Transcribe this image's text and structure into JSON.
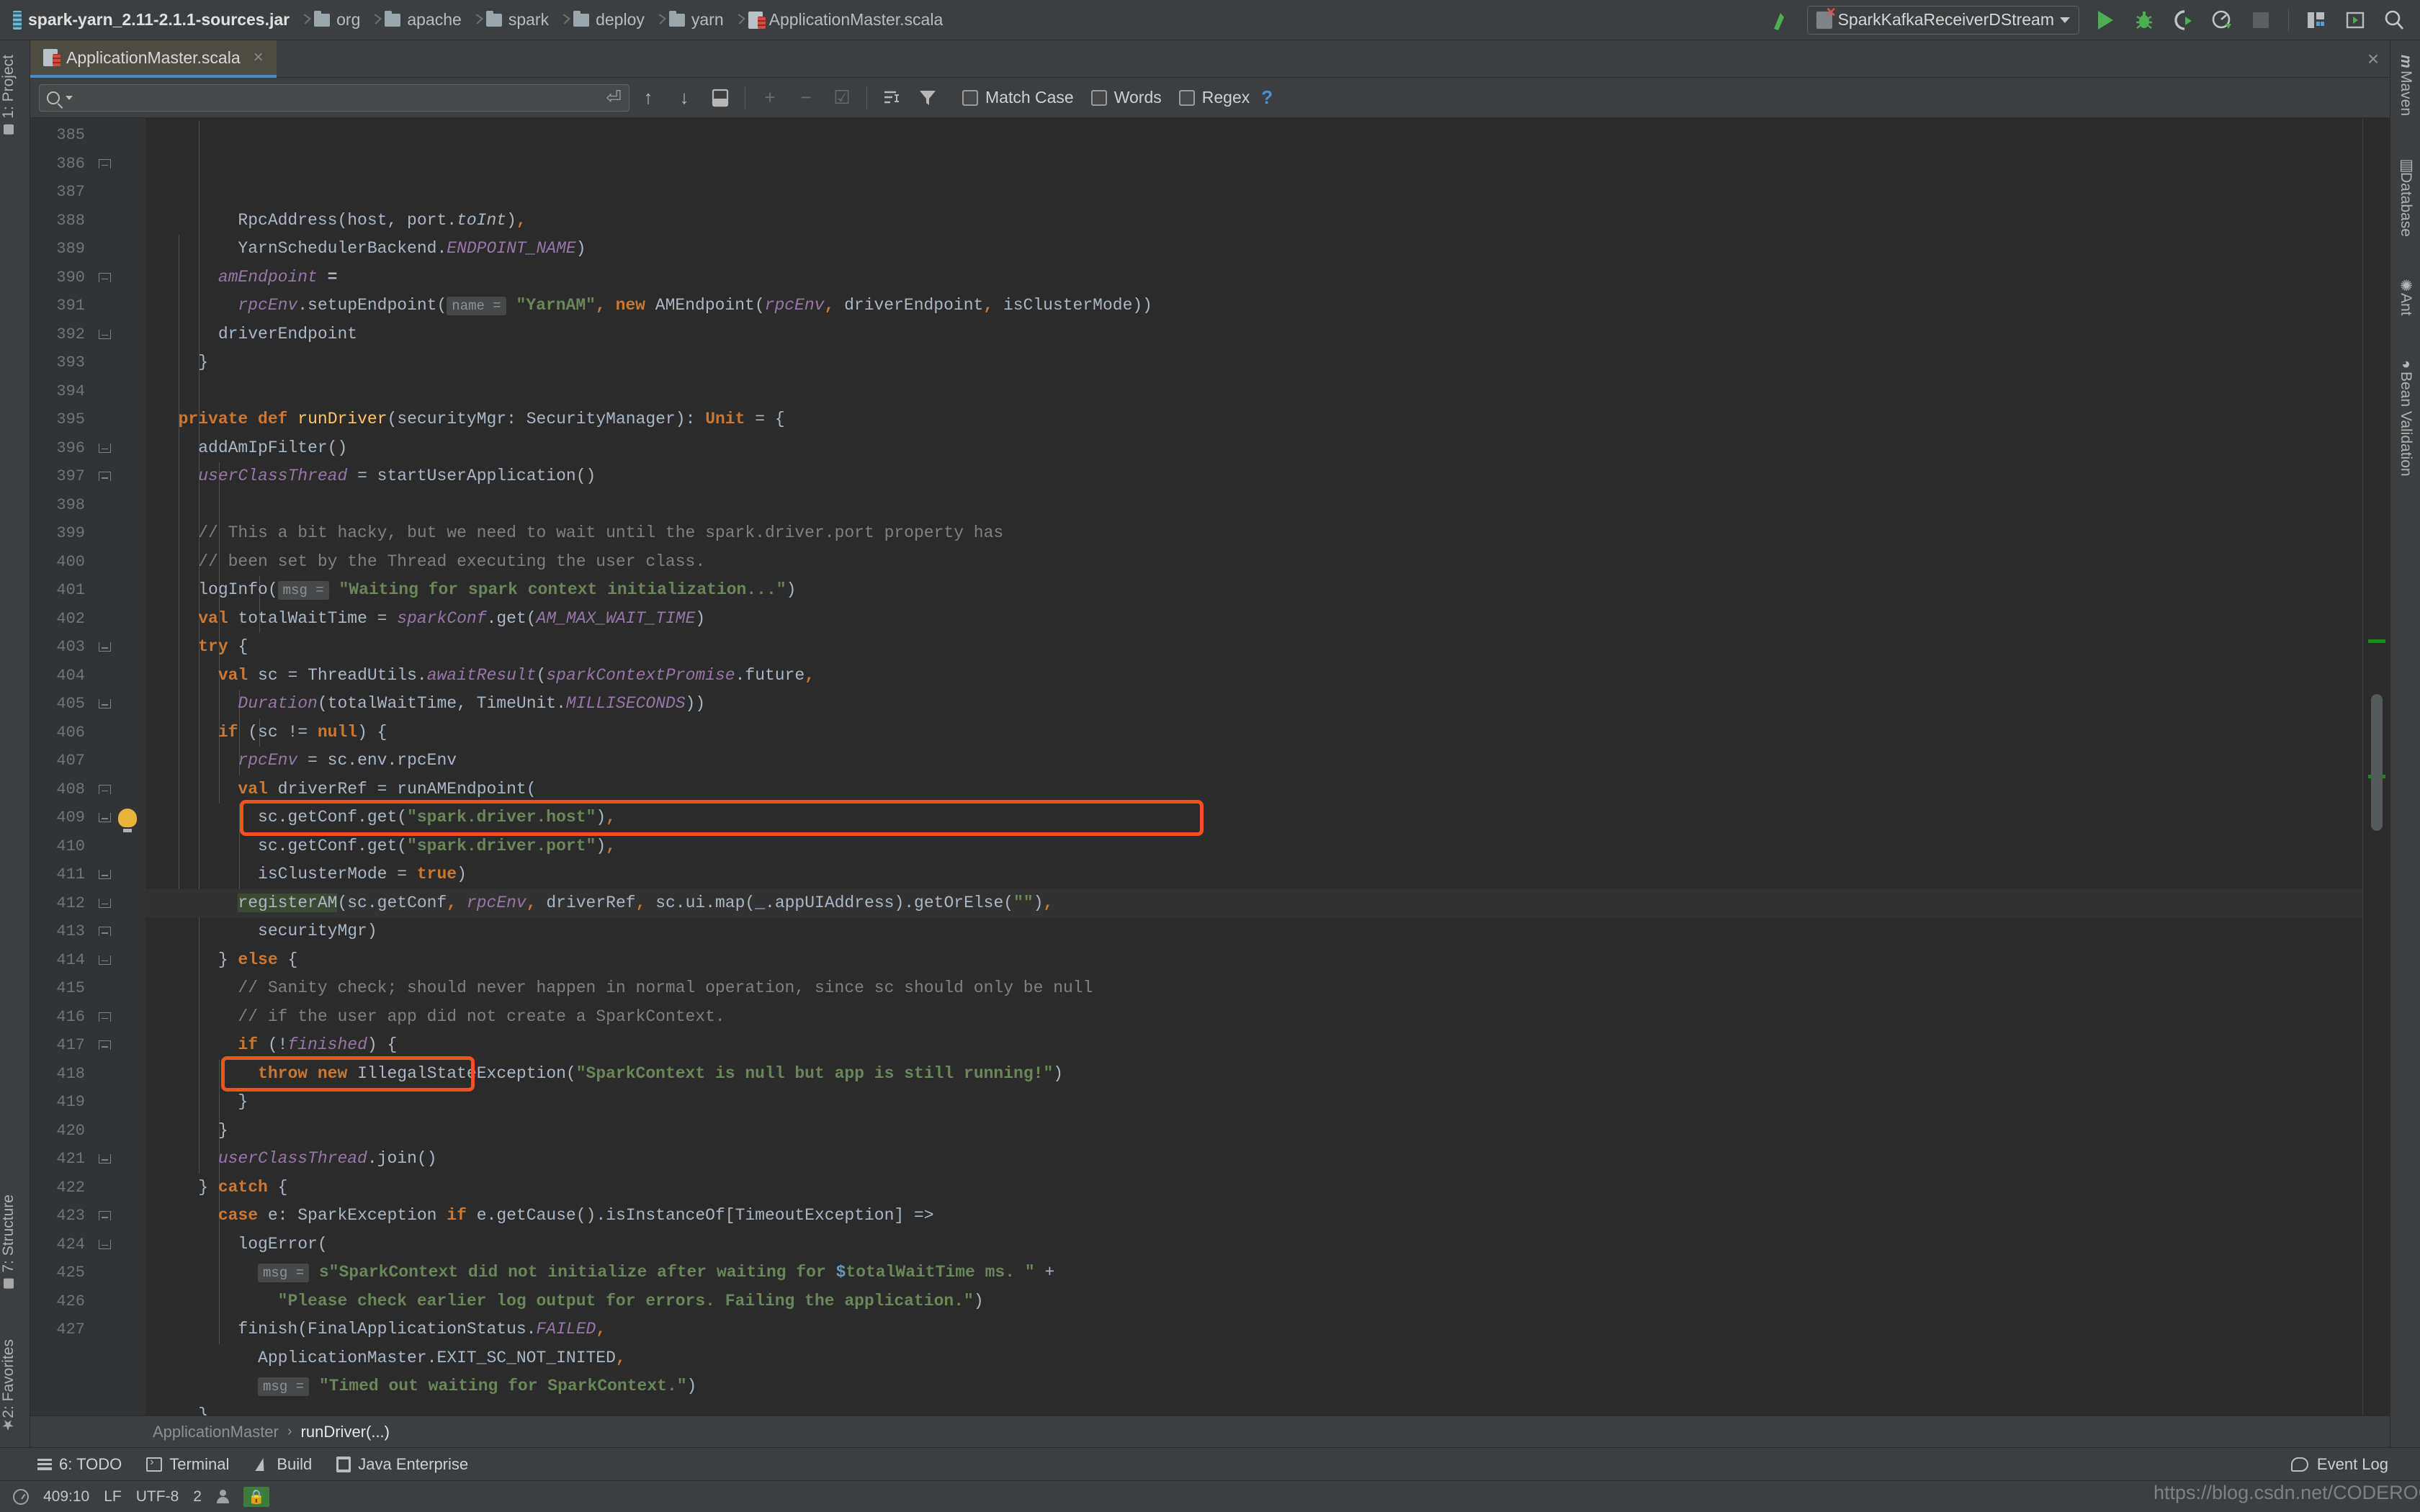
{
  "window": {
    "breadcrumbs": [
      {
        "label": "spark-yarn_2.11-2.1.1-sources.jar",
        "icon": "jar-icon"
      },
      {
        "label": "org",
        "icon": "folder-icon"
      },
      {
        "label": "apache",
        "icon": "folder-icon"
      },
      {
        "label": "spark",
        "icon": "folder-icon"
      },
      {
        "label": "deploy",
        "icon": "folder-icon"
      },
      {
        "label": "yarn",
        "icon": "folder-icon"
      },
      {
        "label": "ApplicationMaster.scala",
        "icon": "scala-file-icon"
      }
    ]
  },
  "toolbar": {
    "build_label": "build-icon",
    "run_config": "SparkKafkaReceiverDStream",
    "actions": [
      "run-icon",
      "debug-icon",
      "run-with-coverage-icon",
      "profile-icon",
      "stop-icon",
      "project-structure-icon",
      "update-app-icon",
      "search-everywhere-icon"
    ]
  },
  "editor_tabs": [
    {
      "label": "ApplicationMaster.scala",
      "close": "×",
      "active": true
    }
  ],
  "find": {
    "value": "",
    "placeholder": "",
    "options": [
      {
        "label": "Match Case",
        "checked": false
      },
      {
        "label": "Words",
        "checked": false
      },
      {
        "label": "Regex",
        "checked": false
      }
    ],
    "help": "?"
  },
  "left_toolwindows": [
    {
      "label": "1: Project"
    },
    {
      "label": "7: Structure"
    },
    {
      "label": "2: Favorites"
    }
  ],
  "right_toolwindows": [
    {
      "label": "Maven",
      "icon": "maven-icon"
    },
    {
      "label": "Database",
      "icon": "database-icon"
    },
    {
      "label": "Ant",
      "icon": "ant-icon"
    },
    {
      "label": "Bean Validation",
      "icon": "bean-validation-icon"
    }
  ],
  "editor": {
    "first_line": 385,
    "cursor_line": 409,
    "lines": [
      {
        "n": 385,
        "fold": "",
        "html": "        RpcAddress(host, port.<i class='id'>toInt</i>)<b class='punc'>,</b>"
      },
      {
        "n": 386,
        "fold": "up",
        "html": "        YarnSchedulerBackend.<i class='stat'>ENDPOINT_NAME</i>)"
      },
      {
        "n": 387,
        "fold": "",
        "html": "      <i class='fld'>amEndpoint</i> <b class='id'>=</b>"
      },
      {
        "n": 388,
        "fold": "",
        "html": "        <i class='fld'>rpcEnv</i>.setupEndpoint(<span class='tag'>name =</span> <b class='str'>\"YarnAM\"</b><b class='punc'>,</b> <b class='kw'>new</b> AMEndpoint(<i class='fld'>rpcEnv</i><b class='punc'>,</b> driverEndpoint<b class='punc'>,</b> isClusterMode))"
      },
      {
        "n": 389,
        "fold": "",
        "html": "      driverEndpoint"
      },
      {
        "n": 390,
        "fold": "up",
        "html": "    }"
      },
      {
        "n": 391,
        "fold": "",
        "html": ""
      },
      {
        "n": 392,
        "fold": "down",
        "html": "  <b class='kw'>private</b> <b class='kw'>def</b> <span class='fn'>runDriver</span>(securityMgr: SecurityManager): <b class='kw'>Unit</b> = {"
      },
      {
        "n": 393,
        "fold": "",
        "html": "    addAmIpFilter()"
      },
      {
        "n": 394,
        "fold": "",
        "html": "    <i class='fld'>userClassThread</i> = startUserApplication()"
      },
      {
        "n": 395,
        "fold": "",
        "html": ""
      },
      {
        "n": 396,
        "fold": "down",
        "html": "    <span class='cmt'>// This a bit hacky, but we need to wait until the spark.driver.port property has</span>"
      },
      {
        "n": 397,
        "fold": "up",
        "html": "    <span class='cmt'>// been set by the Thread executing the user class.</span>"
      },
      {
        "n": 398,
        "fold": "",
        "html": "    logInfo(<span class='tag'>msg =</span> <b class='str'>\"Waiting for spark context initialization...\"</b>)"
      },
      {
        "n": 399,
        "fold": "",
        "html": "    <b class='kw'>val</b> totalWaitTime = <i class='fld'>sparkConf</i>.get(<i class='stat'>AM_MAX_WAIT_TIME</i>)"
      },
      {
        "n": 400,
        "fold": "",
        "html": "    <b class='kw'>try</b> {"
      },
      {
        "n": 401,
        "fold": "",
        "html": "      <b class='kw'>val</b> sc = ThreadUtils.<i class='stat'>awaitResult</i>(<i class='fld'>sparkContextPromise</i>.future<b class='punc'>,</b>"
      },
      {
        "n": 402,
        "fold": "",
        "html": "        <i class='stat'>Duration</i>(totalWaitTime, TimeUnit.<i class='stat'>MILLISECONDS</i>))"
      },
      {
        "n": 403,
        "fold": "down",
        "html": "      <b class='kw'>if</b> (sc != <b class='kw'>null</b>) {"
      },
      {
        "n": 404,
        "fold": "",
        "html": "        <i class='fld'>rpcEnv</i> = sc.env.rpcEnv"
      },
      {
        "n": 405,
        "fold": "down",
        "html": "        <b class='kw'>val</b> driverRef = runAMEndpoint("
      },
      {
        "n": 406,
        "fold": "",
        "html": "          sc.getConf.get(<b class='str'>\"spark.driver.host\"</b>)<b class='punc'>,</b>"
      },
      {
        "n": 407,
        "fold": "",
        "html": "          sc.getConf.get(<b class='str'>\"spark.driver.port\"</b>)<b class='punc'>,</b>"
      },
      {
        "n": 408,
        "fold": "up",
        "html": "          isClusterMode = <b class='kw'>true</b>)"
      },
      {
        "n": 409,
        "fold": "down",
        "bulb": true,
        "html": "        <span class='hl-search'>registerAM</span>(sc.getConf<b class='punc'>,</b> <i class='fld'>rpcEnv</i><b class='punc'>,</b> driverRef<b class='punc'>,</b> sc.ui.map(_.appUIAddress).getOrElse(<b class='str'>\"\"</b>)<b class='punc'>,</b>"
      },
      {
        "n": 410,
        "fold": "",
        "html": "          securityMgr)"
      },
      {
        "n": 411,
        "fold": "down",
        "html": "      } <b class='kw'>else</b> {"
      },
      {
        "n": 412,
        "fold": "down",
        "html": "        <span class='cmt'>// Sanity check; should never happen in normal operation, since sc should only be null</span>"
      },
      {
        "n": 413,
        "fold": "up",
        "html": "        <span class='cmt'>// if the user app did not create a SparkContext.</span>"
      },
      {
        "n": 414,
        "fold": "down",
        "html": "        <b class='kw'>if</b> (!<i class='fld'>finished</i>) {"
      },
      {
        "n": 415,
        "fold": "",
        "html": "          <b class='kw'>throw</b> <b class='kw'>new</b> IllegalStateException(<b class='str'>\"SparkContext is null but app is still running!\"</b>)"
      },
      {
        "n": 416,
        "fold": "up",
        "html": "        }"
      },
      {
        "n": 417,
        "fold": "up",
        "html": "      }"
      },
      {
        "n": 418,
        "fold": "",
        "html": "      <i class='fld'>userClassThread</i>.join()"
      },
      {
        "n": 419,
        "fold": "",
        "html": "    } <b class='kw'>catch</b> {"
      },
      {
        "n": 420,
        "fold": "",
        "html": "      <b class='kw'>case</b> e: SparkException <b class='kw'>if</b> e.getCause().isInstanceOf[TimeoutException] =&gt;"
      },
      {
        "n": 421,
        "fold": "down",
        "html": "        logError("
      },
      {
        "n": 422,
        "fold": "",
        "html": "          <span class='tag'>msg =</span> <b class='str'>s\"SparkContext did not initialize after waiting for <span class='sinterp'>$</span>totalWaitTime ms. \"</b> +"
      },
      {
        "n": 423,
        "fold": "up",
        "html": "            <b class='str'>\"Please check earlier log output for errors. Failing the application.\"</b>)"
      },
      {
        "n": 424,
        "fold": "down",
        "html": "        finish(FinalApplicationStatus.<i class='stat'>FAILED</i><b class='punc'>,</b>"
      },
      {
        "n": 425,
        "fold": "",
        "html": "          ApplicationMaster.EXIT_SC_NOT_INITED<b class='punc'>,</b>"
      },
      {
        "n": 426,
        "fold": "",
        "html": "          <span class='tag'>msg =</span> <b class='str'>\"Timed out waiting for SparkContext.\"</b>)"
      },
      {
        "n": 427,
        "fold": "",
        "html": "    }"
      }
    ],
    "annotations": [
      {
        "name": "registerAM-call-highlight",
        "line": 409,
        "color": "#f4511e"
      },
      {
        "name": "userClassThread-join-highlight",
        "line": 418,
        "color": "#f4511e"
      }
    ]
  },
  "breadcrumb_bar": {
    "parts": [
      "ApplicationMaster",
      "runDriver(...)"
    ],
    "separator": "›"
  },
  "bottom_toolwindows": [
    {
      "label": "6: TODO",
      "mnemonic": "6",
      "icon": "todo-icon"
    },
    {
      "label": "Terminal",
      "icon": "terminal-icon"
    },
    {
      "label": "Build",
      "icon": "build-icon"
    },
    {
      "label": "Java Enterprise",
      "icon": "java-enterprise-icon"
    }
  ],
  "event_log": {
    "label": "Event Log",
    "icon": "balloon-icon"
  },
  "status_bar": {
    "caret": "409:10",
    "line_separator": "LF",
    "encoding": "UTF-8",
    "indent": "2",
    "lock": "lock-icon"
  },
  "watermark": {
    "text": "https://blog.csdn.net/CODEROOKIE_RUN"
  },
  "colors": {
    "background": "#2b2b2b",
    "chrome": "#3c3f41",
    "accent_tab": "#4a88c7",
    "annotation": "#f4511e",
    "keyword": "#cc7832",
    "string": "#6a8759",
    "field": "#9876aa",
    "comment": "#808080",
    "method": "#ffc66d",
    "run_green": "#4caf50"
  }
}
